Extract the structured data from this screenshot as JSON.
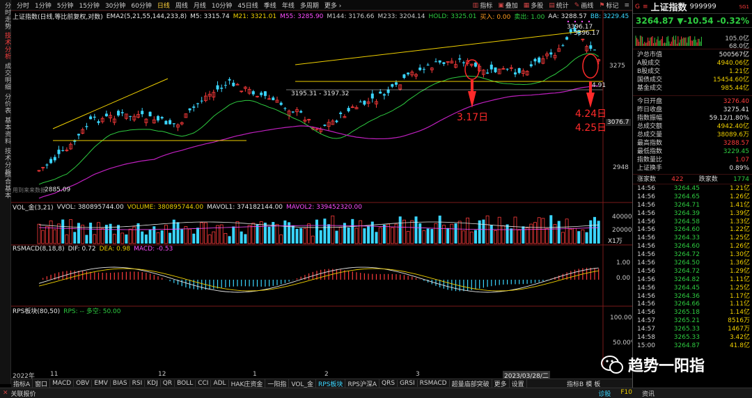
{
  "left_nav": [
    "分时走势",
    "技术分析",
    "成交明细",
    "分价表",
    "基本资料",
    "技术分析",
    "综合基本"
  ],
  "left_nav_active": 1,
  "period_tabs": [
    "分时",
    "1分钟",
    "5分钟",
    "15分钟",
    "30分钟",
    "60分钟",
    "日线",
    "周线",
    "月线",
    "10分钟",
    "45日线",
    "季线",
    "年线",
    "多周期",
    "更多 ›"
  ],
  "period_active": 6,
  "toolbar": {
    "indicator": "指标",
    "overlay": "叠加",
    "multi": "多股",
    "stats": "统计",
    "draw": "画线",
    "mark": "标记"
  },
  "main_legend": [
    {
      "text": "上证指数(日线,等比前复权,对数)",
      "color": "#e8e8e8"
    },
    {
      "text": "EMA2(5,21,55,144,233,8)",
      "color": "#e8e8e8"
    },
    {
      "text": "M5: 3315.74",
      "color": "#e8e8e8"
    },
    {
      "text": "M21: 3321.01",
      "color": "#f0d000"
    },
    {
      "text": "M55: 3285.90",
      "color": "#ff4dff"
    },
    {
      "text": "M144: 3176.66",
      "color": "#c8c8c8"
    },
    {
      "text": "M233: 3204.14",
      "color": "#c8c8c8"
    },
    {
      "text": "HOLD: 3325.01",
      "color": "#2ecc40"
    },
    {
      "text": "买入: 0.00",
      "color": "#ff9a1f"
    },
    {
      "text": "卖出: 1.00",
      "color": "#2ecc40"
    },
    {
      "text": "AA: 3288.57",
      "color": "#e8e8e8"
    },
    {
      "text": "BB: 3229.45",
      "color": "#3ad6ff"
    },
    {
      "text": "高价II: ...",
      "color": "#f0d000"
    },
    {
      "text": "高价III:",
      "color": "#f0d000"
    }
  ],
  "price_axis": [
    "3275",
    "3076.7",
    "2948"
  ],
  "chart_labels": {
    "high1": "3396.17",
    "high2": "3396.17",
    "low": "2885.09",
    "range": "3195.31 - 3197.32",
    "right_low": "4.91",
    "note1": "3.17日",
    "note2": "4.24日",
    "note3": "4.25日",
    "watermark_small": "用到来来数据"
  },
  "vol_legend": [
    {
      "text": "VOL_金(3,21)",
      "color": "#e8e8e8"
    },
    {
      "text": "VVOL: 380895744.00",
      "color": "#e8e8e8"
    },
    {
      "text": "VOLUME: 380895744.00",
      "color": "#f0d000"
    },
    {
      "text": "MAVOL1: 374182144.00",
      "color": "#e8e8e8"
    },
    {
      "text": "MAVOL2: 339452320.00",
      "color": "#ff4dff"
    }
  ],
  "vol_axis": [
    "40000",
    "20000",
    "X1万"
  ],
  "macd_legend": [
    {
      "text": "RSMACD(8,18,8)",
      "color": "#e8e8e8"
    },
    {
      "text": "DIF: 0.72",
      "color": "#e8e8e8"
    },
    {
      "text": "DEA: 0.98",
      "color": "#f0d000"
    },
    {
      "text": "MACD: -0.53",
      "color": "#ff4dff"
    }
  ],
  "macd_axis": [
    "1.00",
    "0.00"
  ],
  "rps_legend": [
    {
      "text": "RPS板块(80,50)",
      "color": "#e8e8e8"
    },
    {
      "text": "RPS: -- 多空: 50.00",
      "color": "#2ecc40"
    }
  ],
  "rps_axis": [
    "100.00%",
    "50.00%"
  ],
  "x_axis": [
    "2022年",
    "11",
    "12",
    "1",
    "2",
    "3",
    "2023/03/28/二"
  ],
  "bottom_tabs": [
    "指标A",
    "窗口",
    "MACD",
    "OBV",
    "EMV",
    "BIAS",
    "RSI",
    "KDJ",
    "QR",
    "BOLL",
    "CCI",
    "ADL",
    "HAK庄资金",
    "一阳指",
    "VOL_金",
    "RPS板块",
    "RPS沪深A",
    "QRS",
    "GRSI",
    "RSMACD",
    "超量庙部突破",
    "更多",
    "设置"
  ],
  "bottom_tab_active": 15,
  "bottom_right": [
    "指标B",
    "模",
    "板"
  ],
  "status": {
    "left": "关联报价",
    "f": "诊股",
    "f10": "F10",
    "news": "资讯"
  },
  "quote": {
    "name": "上证指数",
    "code": "999999",
    "price": "3264.87",
    "change": "▼-10.54",
    "pct": "-0.32%",
    "mini_top": "105.0亿",
    "mini_mid": "68.0亿",
    "rows1": [
      {
        "k": "沪总市值",
        "v": "500567亿",
        "c": "#e8e8e8"
      },
      {
        "k": "A股成交",
        "v": "4940.06亿",
        "c": "#f0d000"
      },
      {
        "k": "B股成交",
        "v": "1.21亿",
        "c": "#f0d000"
      },
      {
        "k": "国债成交",
        "v": "15454.60亿",
        "c": "#f0d000"
      },
      {
        "k": "基金成交",
        "v": "985.44亿",
        "c": "#f0d000"
      }
    ],
    "rows2": [
      {
        "k": "今日开盘",
        "v": "3276.40",
        "c": "#ff3b3b"
      },
      {
        "k": "昨日收盘",
        "v": "3275.41",
        "c": "#e8e8e8"
      },
      {
        "k": "指数振幅",
        "v": "59.12/1.80%",
        "c": "#e8e8e8"
      },
      {
        "k": "总成交额",
        "v": "4942.40亿",
        "c": "#f0d000"
      },
      {
        "k": "总成交量",
        "v": "38089.6万",
        "c": "#f0d000"
      },
      {
        "k": "最高指数",
        "v": "3288.57",
        "c": "#ff3b3b"
      },
      {
        "k": "最低指数",
        "v": "3229.45",
        "c": "#2ecc40"
      },
      {
        "k": "指数量比",
        "v": "1.07",
        "c": "#ff3b3b"
      },
      {
        "k": "上证换手",
        "v": "0.89%",
        "c": "#e8e8e8"
      }
    ],
    "updown": {
      "up_label": "涨家数",
      "up": "422",
      "down_label": "跌家数",
      "down": "1774"
    },
    "ticks": [
      [
        "14:56",
        "3264.45",
        "1.21亿"
      ],
      [
        "14:56",
        "3264.65",
        "1.26亿"
      ],
      [
        "14:56",
        "3264.71",
        "1.41亿"
      ],
      [
        "14:56",
        "3264.39",
        "1.39亿"
      ],
      [
        "14:56",
        "3264.58",
        "1.33亿"
      ],
      [
        "14:56",
        "3264.60",
        "1.22亿"
      ],
      [
        "14:56",
        "3264.33",
        "1.25亿"
      ],
      [
        "14:56",
        "3264.60",
        "1.26亿"
      ],
      [
        "14:56",
        "3264.72",
        "1.30亿"
      ],
      [
        "14:56",
        "3264.50",
        "1.36亿"
      ],
      [
        "14:56",
        "3264.72",
        "1.29亿"
      ],
      [
        "14:56",
        "3264.82",
        "1.11亿"
      ],
      [
        "14:56",
        "3264.45",
        "1.25亿"
      ],
      [
        "14:56",
        "3264.36",
        "1.17亿"
      ],
      [
        "14:56",
        "3264.66",
        "1.11亿"
      ],
      [
        "14:56",
        "3265.18",
        "1.14亿"
      ],
      [
        "14:57",
        "3265.21",
        "8516万"
      ],
      [
        "14:57",
        "3265.33",
        "1467万"
      ],
      [
        "14:58",
        "3265.33",
        "3.42亿"
      ],
      [
        "15:00",
        "3264.87",
        "41.8亿"
      ]
    ],
    "watermark": "趋势一阳指"
  }
}
